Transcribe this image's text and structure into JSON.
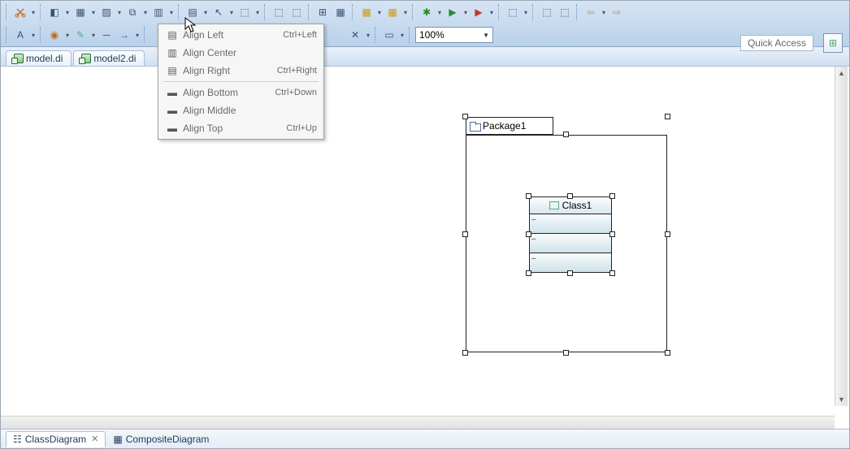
{
  "toolbar": {
    "zoom_value": "100%"
  },
  "quick_access_label": "Quick Access",
  "tabs": [
    {
      "label": "model.di"
    },
    {
      "label": "model2.di"
    }
  ],
  "menu": {
    "items": [
      {
        "icon": "align-left-icon",
        "label": "Align Left",
        "shortcut": "Ctrl+Left"
      },
      {
        "icon": "align-center-icon",
        "label": "Align Center",
        "shortcut": ""
      },
      {
        "icon": "align-right-icon",
        "label": "Align Right",
        "shortcut": "Ctrl+Right"
      }
    ],
    "items2": [
      {
        "icon": "align-bottom-icon",
        "label": "Align Bottom",
        "shortcut": "Ctrl+Down"
      },
      {
        "icon": "align-middle-icon",
        "label": "Align Middle",
        "shortcut": ""
      },
      {
        "icon": "align-top-icon",
        "label": "Align Top",
        "shortcut": "Ctrl+Up"
      }
    ]
  },
  "diagram": {
    "package_label": "Package1",
    "class_label": "Class1"
  },
  "bottom_tabs": {
    "active": "ClassDiagram",
    "other": "CompositeDiagram"
  }
}
